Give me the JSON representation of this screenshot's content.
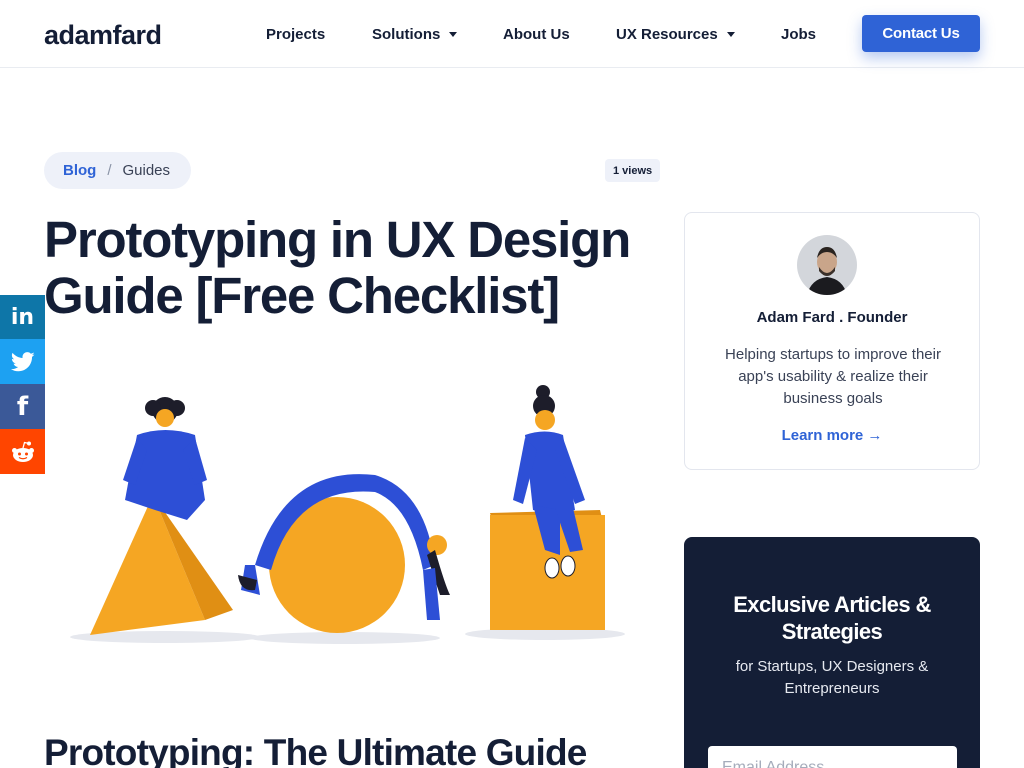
{
  "header": {
    "logo": "adamfard",
    "nav": [
      {
        "label": "Projects",
        "dropdown": false
      },
      {
        "label": "Solutions",
        "dropdown": true
      },
      {
        "label": "About Us",
        "dropdown": false
      },
      {
        "label": "UX Resources",
        "dropdown": true
      },
      {
        "label": "Jobs",
        "dropdown": false
      }
    ],
    "contact_label": "Contact Us"
  },
  "breadcrumb": {
    "blog": "Blog",
    "separator": "/",
    "current": "Guides"
  },
  "views": "1 views",
  "article": {
    "title": "Prototyping in UX Design Guide [Free Checklist]",
    "subheading": "Prototyping: The Ultimate Guide"
  },
  "social": [
    {
      "name": "linkedin",
      "glyph": "in"
    },
    {
      "name": "twitter",
      "glyph": ""
    },
    {
      "name": "facebook",
      "glyph": "f"
    },
    {
      "name": "reddit",
      "glyph": ""
    }
  ],
  "author": {
    "name": "Adam Fard . Founder",
    "description": "Helping startups to improve their app's usability & realize their business goals",
    "learn_more": "Learn more →"
  },
  "newsletter": {
    "title": "Exclusive Articles & Strategies",
    "subtitle": "for Startups, UX Designers & Entrepreneurs",
    "email_placeholder": "Email Address"
  },
  "colors": {
    "accent": "#2f63d6",
    "navy": "#141e36",
    "illustration_orange": "#f5a623",
    "illustration_blue": "#2d4fd6",
    "linkedin": "#0e76a8",
    "twitter": "#1da1f2",
    "facebook": "#3b5998",
    "reddit": "#ff4500"
  }
}
